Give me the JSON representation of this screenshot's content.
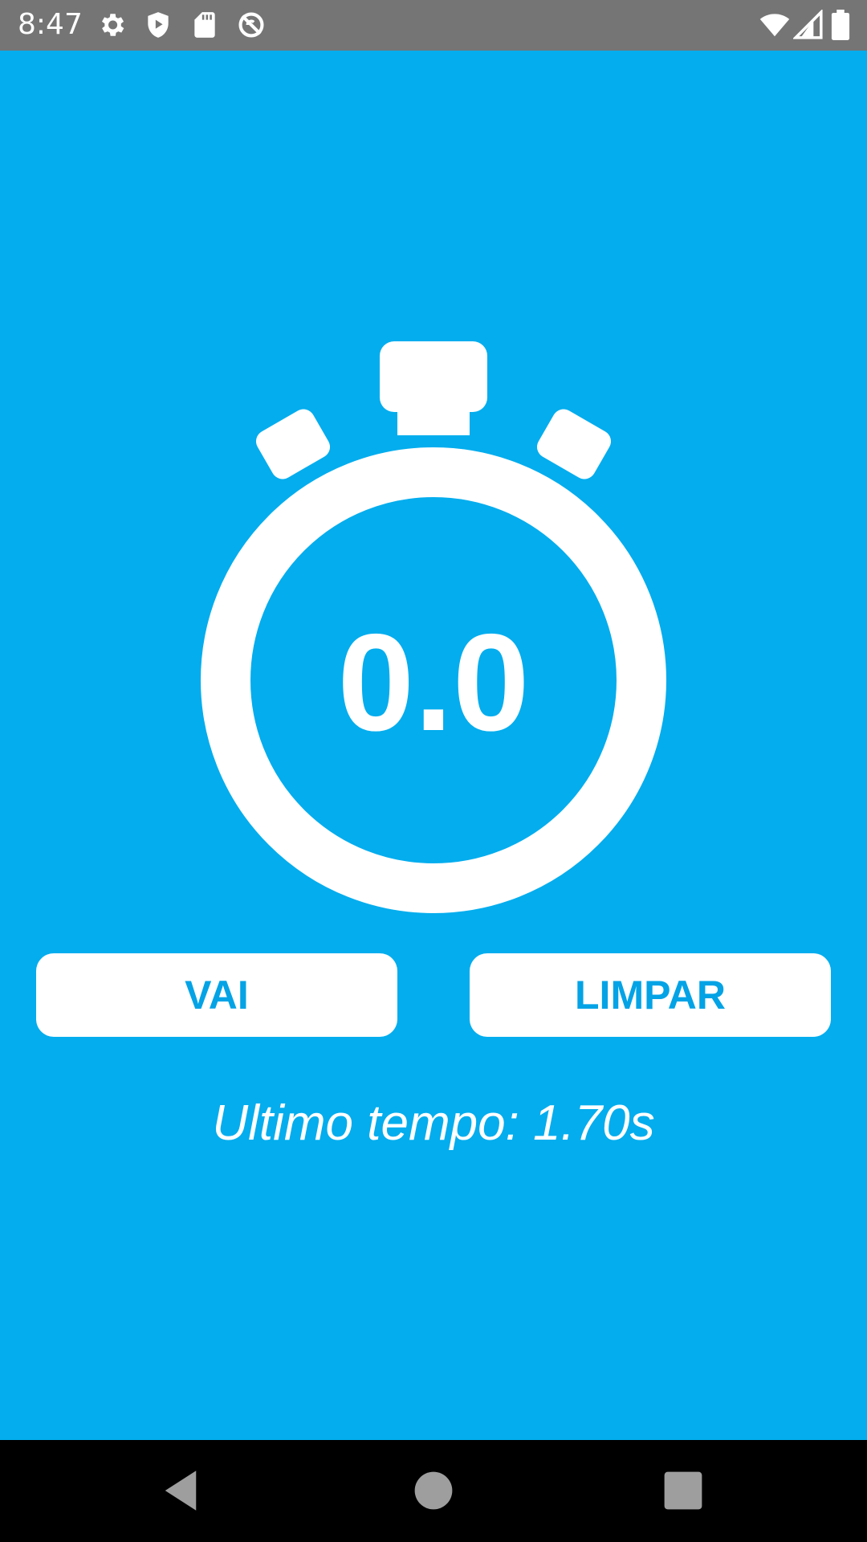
{
  "status_bar": {
    "time": "8:47",
    "left_icons": [
      "settings-gear-icon",
      "shield-play-icon",
      "sd-card-icon",
      "no-sync-icon"
    ],
    "right_icons": [
      "wifi-icon",
      "cell-signal-icon",
      "battery-icon"
    ]
  },
  "app": {
    "background_color": "#03adee",
    "timer_value": "0.0",
    "go_button_label": "VAI",
    "clear_button_label": "LIMPAR",
    "last_time_text": "Ultimo tempo: 1.70s",
    "accent_color": "#03a3e6"
  },
  "nav_bar": {
    "buttons": [
      "back-icon",
      "home-icon",
      "recents-icon"
    ]
  }
}
